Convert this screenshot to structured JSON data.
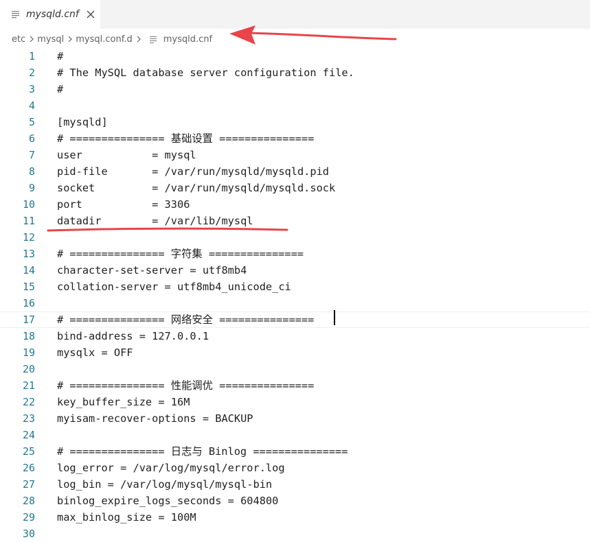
{
  "tab": {
    "label": "mysqld.cnf",
    "icon": "lines-file-icon",
    "close_icon": "close-icon"
  },
  "breadcrumb": {
    "items": [
      "etc",
      "mysql",
      "mysql.conf.d",
      "mysqld.cnf"
    ],
    "separator_icon": "chevron-right-icon",
    "file_icon": "lines-file-icon"
  },
  "annotations": {
    "arrow_color": "#e8444a",
    "underline_color": "#e8444a"
  },
  "colors": {
    "line_number": "#237893",
    "text": "#1f1f1f",
    "tab_bar": "#f3f3f3"
  },
  "editor": {
    "lines": [
      {
        "num": "1",
        "text": "#"
      },
      {
        "num": "2",
        "text": "# The MySQL database server configuration file."
      },
      {
        "num": "3",
        "text": "#"
      },
      {
        "num": "4",
        "text": ""
      },
      {
        "num": "5",
        "text": "[mysqld]"
      },
      {
        "num": "6",
        "text": "# =============== 基础设置 ==============="
      },
      {
        "num": "7",
        "text": "user           = mysql"
      },
      {
        "num": "8",
        "text": "pid-file       = /var/run/mysqld/mysqld.pid"
      },
      {
        "num": "9",
        "text": "socket         = /var/run/mysqld/mysqld.sock"
      },
      {
        "num": "10",
        "text": "port           = 3306"
      },
      {
        "num": "11",
        "text": "datadir        = /var/lib/mysql"
      },
      {
        "num": "12",
        "text": ""
      },
      {
        "num": "13",
        "text": "# =============== 字符集 ==============="
      },
      {
        "num": "14",
        "text": "character-set-server = utf8mb4"
      },
      {
        "num": "15",
        "text": "collation-server = utf8mb4_unicode_ci"
      },
      {
        "num": "16",
        "text": ""
      },
      {
        "num": "17",
        "text": "# =============== 网络安全 ==============="
      },
      {
        "num": "18",
        "text": "bind-address = 127.0.0.1"
      },
      {
        "num": "19",
        "text": "mysqlx = OFF"
      },
      {
        "num": "20",
        "text": ""
      },
      {
        "num": "21",
        "text": "# =============== 性能调优 ==============="
      },
      {
        "num": "22",
        "text": "key_buffer_size = 16M"
      },
      {
        "num": "23",
        "text": "myisam-recover-options = BACKUP"
      },
      {
        "num": "24",
        "text": ""
      },
      {
        "num": "25",
        "text": "# =============== 日志与 Binlog ==============="
      },
      {
        "num": "26",
        "text": "log_error = /var/log/mysql/error.log"
      },
      {
        "num": "27",
        "text": "log_bin = /var/log/mysql/mysql-bin"
      },
      {
        "num": "28",
        "text": "binlog_expire_logs_seconds = 604800"
      },
      {
        "num": "29",
        "text": "max_binlog_size = 100M"
      },
      {
        "num": "30",
        "text": ""
      }
    ]
  }
}
